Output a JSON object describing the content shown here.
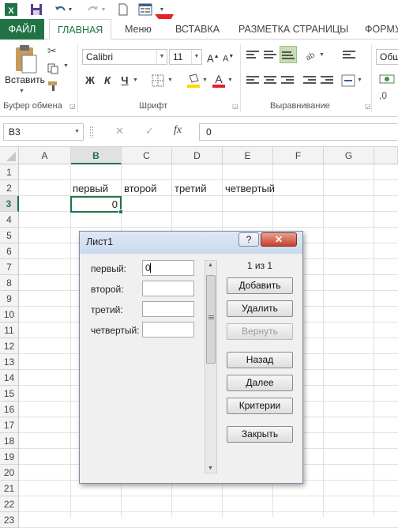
{
  "qat": {
    "excel_icon": "excel-app-icon",
    "save_icon": "save-icon",
    "undo_icon": "undo-icon",
    "redo_icon": "redo-icon",
    "new_icon": "new-document-icon",
    "form_icon": "form-icon"
  },
  "tabs": {
    "file": "ФАЙЛ",
    "home": "ГЛАВНАЯ",
    "menu": "Меню",
    "insert": "ВСТАВКА",
    "page_layout": "РАЗМЕТКА СТРАНИЦЫ",
    "formulas": "ФОРМУ"
  },
  "ribbon": {
    "paste_label": "Вставить",
    "clipboard_group": "Буфер обмена",
    "font_name": "Calibri",
    "font_size": "11",
    "bold": "Ж",
    "italic": "К",
    "underline": "Ч",
    "font_group": "Шрифт",
    "alignment_group": "Выравнивание",
    "number_format": "Общ",
    "accent_color": "#217346",
    "arrow_color": "#e8202a"
  },
  "formula_bar": {
    "name_box": "B3",
    "fx_label": "fx",
    "value": "0"
  },
  "grid": {
    "columns": [
      "A",
      "B",
      "C",
      "D",
      "E",
      "F",
      "G"
    ],
    "rows": [
      "1",
      "2",
      "3",
      "4",
      "5",
      "6",
      "7",
      "8",
      "9",
      "10",
      "11",
      "12",
      "13",
      "14",
      "15",
      "16",
      "17",
      "18",
      "19",
      "20",
      "21",
      "22",
      "23"
    ],
    "selected_column": "B",
    "selected_row": "3",
    "headers": [
      "первый",
      "второй",
      "третий",
      "четвертый"
    ],
    "b3_value": "0"
  },
  "dialog": {
    "title": "Лист1",
    "help": "?",
    "close": "✕",
    "record_counter": "1 из 1",
    "fields": [
      {
        "label": "первый:",
        "value": "0"
      },
      {
        "label": "второй:",
        "value": ""
      },
      {
        "label": "третий:",
        "value": ""
      },
      {
        "label": "четвертый:",
        "value": ""
      }
    ],
    "buttons": {
      "add": "Добавить",
      "delete": "Удалить",
      "restore": "Вернуть",
      "prev": "Назад",
      "next": "Далее",
      "criteria": "Критерии",
      "close": "Закрыть"
    }
  }
}
